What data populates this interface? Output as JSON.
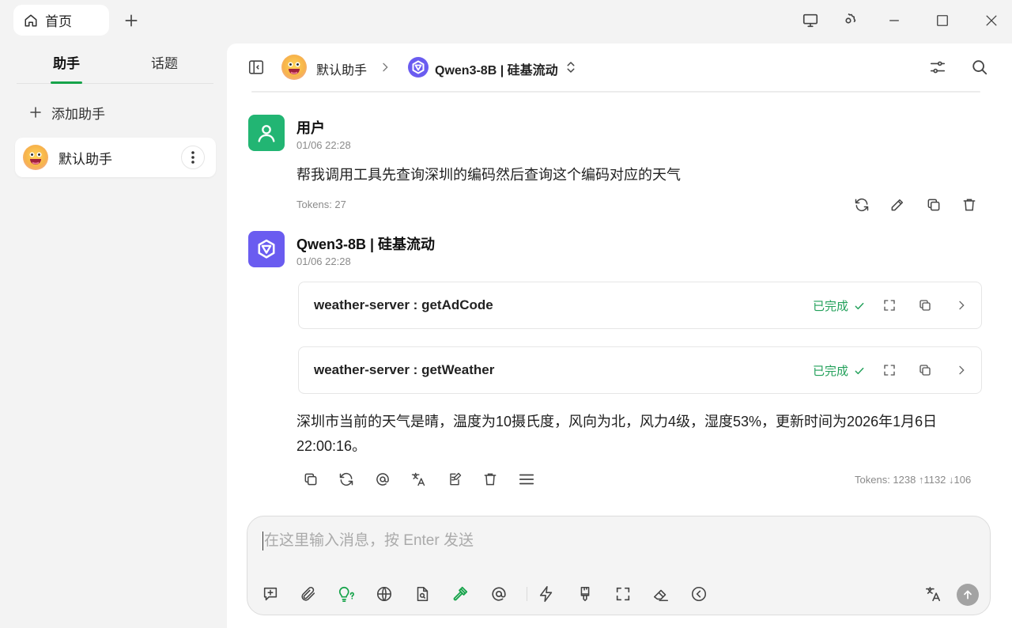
{
  "titlebar": {
    "home_tab": "首页",
    "icons": [
      "home-icon",
      "plus-icon",
      "monitor-icon",
      "gear-icon",
      "minimize-icon",
      "maximize-icon",
      "close-icon"
    ]
  },
  "sidebar": {
    "tabs": [
      {
        "label": "助手",
        "active": true
      },
      {
        "label": "话题",
        "active": false
      }
    ],
    "add_assistant": "添加助手",
    "assistants": [
      {
        "name": "默认助手"
      }
    ]
  },
  "header": {
    "assistant": "默认助手",
    "model": "Qwen3-8B | 硅基流动"
  },
  "messages": [
    {
      "role": "user",
      "name": "用户",
      "time": "01/06 22:28",
      "text": "帮我调用工具先查询深圳的编码然后查询这个编码对应的天气",
      "tokens": "Tokens: 27"
    },
    {
      "role": "assistant",
      "name": "Qwen3-8B | 硅基流动",
      "time": "01/06 22:28",
      "tools": [
        {
          "name": "weather-server : getAdCode",
          "status": "已完成"
        },
        {
          "name": "weather-server : getWeather",
          "status": "已完成"
        }
      ],
      "text_line1": "深圳市当前的天气是晴，温度为10摄氏度，风向为北，风力4级，湿度53%，更新时间为2026年1月6日",
      "text_line2": "22:00:16。",
      "tokens": "Tokens: 1238 ↑1132 ↓106"
    }
  ],
  "input": {
    "placeholder": "在这里输入消息，按 Enter 发送"
  },
  "colors": {
    "accent": "#16a34a",
    "user_avatar": "#22b573",
    "qwen_avatar": "#6a5cf0",
    "done": "#22a05a"
  }
}
